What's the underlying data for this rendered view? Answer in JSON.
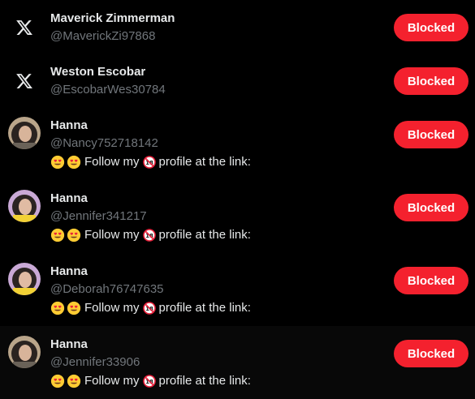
{
  "accent_color": "#f4212e",
  "users": [
    {
      "name": "Maverick Zimmerman",
      "handle": "@MaverickZi97868",
      "avatar": "x-logo-icon",
      "bio_text": "",
      "button_label": "Blocked"
    },
    {
      "name": "Weston Escobar",
      "handle": "@EscobarWes30784",
      "avatar": "x-logo-icon",
      "bio_text": "",
      "button_label": "Blocked"
    },
    {
      "name": "Hanna",
      "handle": "@Nancy752718142",
      "avatar": "profile-photo",
      "bio_text": "profile at the link:",
      "bio_prefix": "Follow my",
      "button_label": "Blocked"
    },
    {
      "name": "Hanna",
      "handle": "@Jennifer341217",
      "avatar": "profile-photo",
      "bio_text": "profile at the link:",
      "bio_prefix": "Follow my",
      "button_label": "Blocked"
    },
    {
      "name": "Hanna",
      "handle": "@Deborah76747635",
      "avatar": "profile-photo",
      "bio_text": "profile at the link:",
      "bio_prefix": "Follow my",
      "button_label": "Blocked"
    },
    {
      "name": "Hanna",
      "handle": "@Jennifer33906",
      "avatar": "profile-photo",
      "bio_text": "profile at the link:",
      "bio_prefix": "Follow my",
      "button_label": "Blocked"
    }
  ]
}
